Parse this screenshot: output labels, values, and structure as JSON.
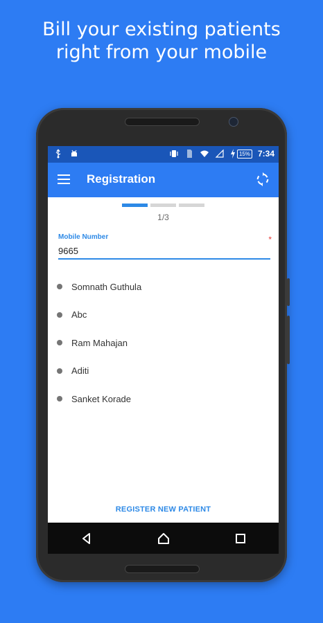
{
  "promo": {
    "line1": "Bill your existing patients",
    "line2": "right from your mobile"
  },
  "status_bar": {
    "battery": "15%",
    "time": "7:34",
    "icons": [
      "usb-icon",
      "android-debug-icon",
      "vibrate-icon",
      "sim-icon",
      "wifi-icon",
      "signal-icon",
      "charging-icon"
    ]
  },
  "app_bar": {
    "title": "Registration",
    "menu_icon": "hamburger-menu-icon",
    "action_icon": "sync-icon"
  },
  "stepper": {
    "current": 1,
    "total": 3,
    "label": "1/3"
  },
  "mobile_field": {
    "label": "Mobile Number",
    "required_mark": "*",
    "value": "9665"
  },
  "patients": [
    {
      "name": "Somnath Guthula"
    },
    {
      "name": "Abc"
    },
    {
      "name": "Ram Mahajan"
    },
    {
      "name": "Aditi"
    },
    {
      "name": "Sanket Korade"
    }
  ],
  "register_button": "REGISTER NEW PATIENT",
  "nav_bar": {
    "icons": [
      "back-icon",
      "home-icon",
      "recents-icon"
    ]
  },
  "colors": {
    "background": "#2d7cf3",
    "app_bar": "#2d7cf3",
    "status_bar": "#1a56b8",
    "accent": "#2d89e6",
    "required": "#e53935"
  }
}
